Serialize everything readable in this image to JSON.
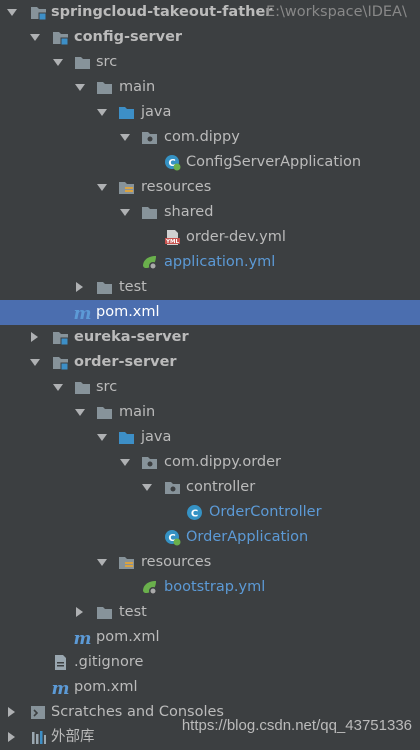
{
  "tree": {
    "root": {
      "label": "springcloud-takeout-father",
      "path": "E:\\workspace\\IDEA\\"
    },
    "config_server": {
      "label": "config-server",
      "src": "src",
      "main": "main",
      "java": "java",
      "package": "com.dippy",
      "app_class": "ConfigServerApplication",
      "resources": "resources",
      "shared": "shared",
      "shared_file": "order-dev.yml",
      "app_yml": "application.yml",
      "test": "test",
      "pom": "pom.xml"
    },
    "eureka_server": {
      "label": "eureka-server"
    },
    "order_server": {
      "label": "order-server",
      "src": "src",
      "main": "main",
      "java": "java",
      "package": "com.dippy.order",
      "controller_pkg": "controller",
      "controller_class": "OrderController",
      "app_class": "OrderApplication",
      "resources": "resources",
      "bootstrap": "bootstrap.yml",
      "test": "test",
      "pom": "pom.xml"
    },
    "gitignore": ".gitignore",
    "root_pom": "pom.xml",
    "scratches": "Scratches and Consoles",
    "external_libs": "外部库"
  },
  "watermark": "https://blog.csdn.net/qq_43751336",
  "colors": {
    "background": "#3c3f41",
    "selection": "#4b6eaf",
    "text": "#bbbbbb",
    "link_blue": "#5c9ad6",
    "folder": "#87939a",
    "source_folder": "#3d8fc7",
    "spring_green": "#6ab04c",
    "class_blue": "#3592c4"
  },
  "icons": {
    "module": "module-folder-icon",
    "folder": "folder-icon",
    "source_root": "source-root-folder-icon",
    "resources_root": "resources-root-folder-icon",
    "package": "package-icon",
    "spring_boot_class": "spring-boot-class-icon",
    "class": "class-icon",
    "yml": "yml-file-icon",
    "spring_config": "spring-config-file-icon",
    "maven": "maven-pom-icon",
    "gitignore": "gitignore-file-icon",
    "scratches": "scratches-icon",
    "libraries": "libraries-icon"
  }
}
